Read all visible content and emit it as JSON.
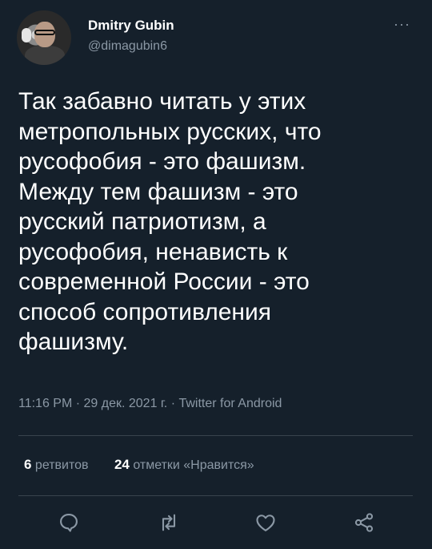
{
  "author": {
    "display_name": "Dmitry Gubin",
    "handle": "@dimagubin6"
  },
  "more_icon": "ellipsis-icon",
  "tweet": {
    "text": "Так забавно читать у этих\nметропольных русских, что\nрусофобия - это фашизм.\nМежду тем фашизм - это\nрусский патриотизм, а\nрусофобия, ненависть к\nсовременной России - это\nспособ сопротивления\nфашизму.",
    "meta": "11:16 PM · 29 дек. 2021 г. · Twitter for Android"
  },
  "stats": {
    "retweets_count": "6",
    "retweets_label": "ретвитов",
    "likes_count": "24",
    "likes_label": "отметки «Нравится»"
  },
  "actions": [
    "reply-icon",
    "retweet-icon",
    "like-icon",
    "share-icon"
  ],
  "colors": {
    "background": "#15202b",
    "secondary_text": "#8b98a5",
    "divider": "#38444d"
  }
}
